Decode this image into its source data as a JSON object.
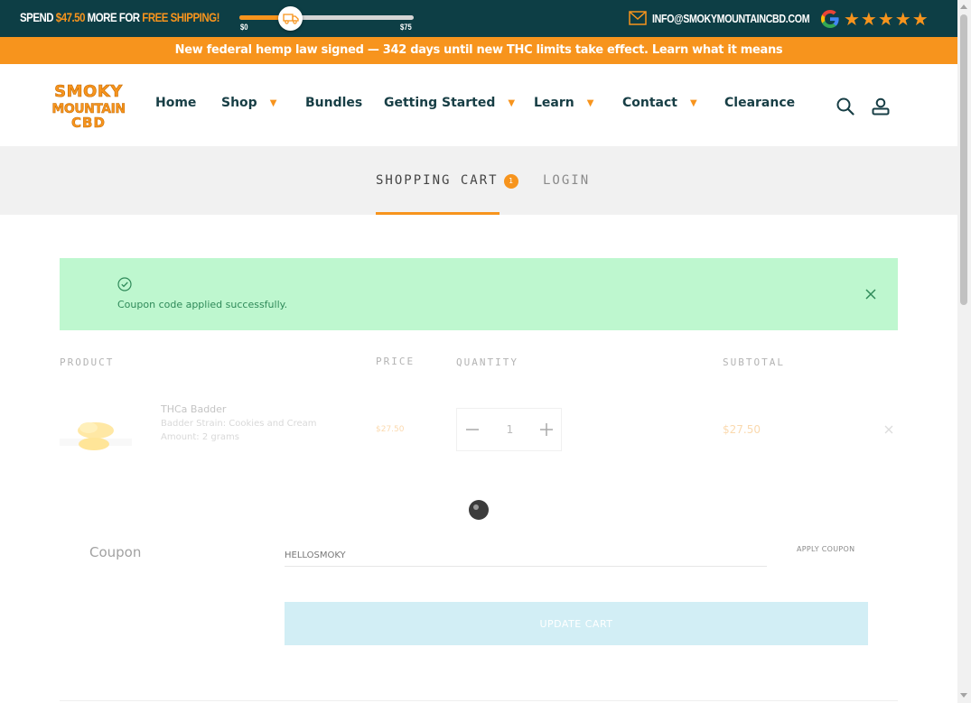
{
  "shipping_bar": {
    "prefix": "SPEND ",
    "amount": "$47.50",
    "middle": " MORE FOR ",
    "highlight": "FREE SHIPPING!",
    "progress_fraction": 0.29,
    "min_label": "$0",
    "max_label": "$75",
    "email": "INFO@SMOKYMOUNTAINCBD.COM",
    "rating_stars": "★★★★★",
    "rating_count": 5
  },
  "announcement": {
    "text": "New federal hemp law signed — 342 days until new THC limits take effect. Learn what it means"
  },
  "header": {
    "logo_text": [
      "SMOKY",
      "MOUNTAIN",
      "CBD"
    ],
    "nav": {
      "home": "Home",
      "shop": "Shop",
      "bundles": "Bundles",
      "getting_started": "Getting Started",
      "learn": "Learn",
      "contact": "Contact",
      "clearance": "Clearance"
    },
    "caret": "▼"
  },
  "tabs": {
    "cart": "SHOPPING CART",
    "cart_count": "1",
    "login": "LOGIN"
  },
  "notice": {
    "message": "Coupon code applied successfully."
  },
  "cart": {
    "columns": {
      "product": "PRODUCT",
      "price": "PRICE",
      "quantity": "QUANTITY",
      "subtotal": "SUBTOTAL"
    },
    "item": {
      "name": "THCa Badder",
      "strain": "Badder Strain: Cookies and Cream",
      "amount": "Amount: 2 grams",
      "price": "$27.50",
      "quantity": "1",
      "subtotal": "$27.50"
    }
  },
  "coupon": {
    "label": "Coupon",
    "code": "HELLOSMOKY",
    "apply_label": "APPLY COUPON",
    "update_label": "UPDATE CART"
  },
  "colors": {
    "dark_teal": "#0d3e45",
    "orange": "#f7941d",
    "nav_text": "#173e45",
    "success_bg": "#bef7cf",
    "success_text": "#2f8a59",
    "update_btn": "#d2eef5"
  }
}
